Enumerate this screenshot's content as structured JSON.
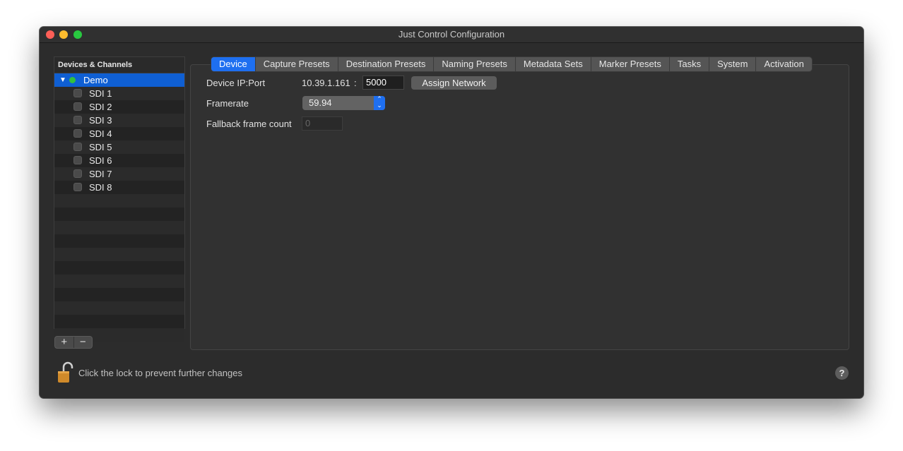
{
  "window": {
    "title": "Just Control Configuration"
  },
  "sidebar": {
    "header": "Devices & Channels",
    "device": {
      "label": "Demo",
      "status_color": "#32c13e"
    },
    "channels": [
      "SDI 1",
      "SDI 2",
      "SDI 3",
      "SDI 4",
      "SDI 5",
      "SDI 6",
      "SDI 7",
      "SDI 8"
    ],
    "add_label": "+",
    "remove_label": "−"
  },
  "tabs": [
    "Device",
    "Capture Presets",
    "Destination Presets",
    "Naming Presets",
    "Metadata Sets",
    "Marker Presets",
    "Tasks",
    "System",
    "Activation"
  ],
  "active_tab": "Device",
  "device": {
    "ip_label": "Device IP:Port",
    "ip": "10.39.1.161",
    "separator": ":",
    "port": "5000",
    "assign_button": "Assign Network",
    "framerate_label": "Framerate",
    "framerate_value": "59.94",
    "fallback_label": "Fallback frame count",
    "fallback_value": "0"
  },
  "footer": {
    "lock_text": "Click the lock to prevent further changes",
    "help_label": "?"
  },
  "colors": {
    "accent": "#1e6ff0",
    "selection": "#0f5fd3"
  }
}
